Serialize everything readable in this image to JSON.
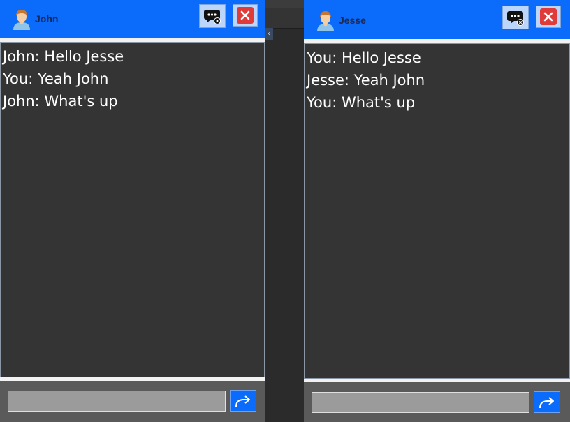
{
  "windows": [
    {
      "title": "John",
      "input_value": "",
      "messages": [
        "John: Hello Jesse",
        "You: Yeah John",
        "John: What's up"
      ]
    },
    {
      "title": "Jesse",
      "input_value": "",
      "messages": [
        "You: Hello Jesse",
        "Jesse: Yeah John",
        "You: What's up"
      ]
    }
  ],
  "icons": {
    "avatar": "user-avatar-icon",
    "end_chat": "chat-bubble-close-icon",
    "close": "close-icon",
    "send": "send-arrow-icon"
  },
  "colors": {
    "header": "#0b6bfa",
    "chat_background": "#343434",
    "message_text": "#ffffff",
    "close_button": "#e03b3b"
  }
}
